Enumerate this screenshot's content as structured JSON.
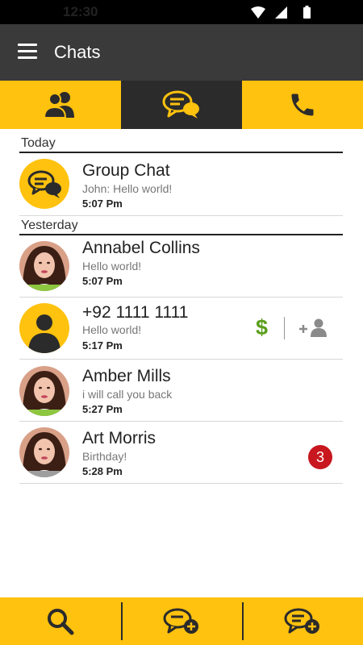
{
  "status_bar": {
    "time": "12:30"
  },
  "app_bar": {
    "title": "Chats",
    "menu_icon": "hamburger-menu-icon"
  },
  "tabs": [
    {
      "icon": "contacts-icon",
      "active": false
    },
    {
      "icon": "chat-bubbles-icon",
      "active": true
    },
    {
      "icon": "phone-icon",
      "active": false
    }
  ],
  "sections": {
    "today": "Today",
    "yesterday": "Yesterday"
  },
  "chats": [
    {
      "name": "Group Chat",
      "message": "John: Hello world!",
      "time": "5:07 Pm",
      "avatar": "group-chat-icon"
    },
    {
      "name": "Annabel Collins",
      "message": "Hello world!",
      "time": "5:07 Pm",
      "avatar": "photo",
      "presence": "#8dc63f"
    },
    {
      "name": "+92 1111 1111",
      "message": "Hello world!",
      "time": "5:17 Pm",
      "avatar": "default-user-icon",
      "action_symbol": "$"
    },
    {
      "name": "Amber Mills",
      "message": "i will call you back",
      "time": "5:27 Pm",
      "avatar": "photo",
      "presence": "#8dc63f"
    },
    {
      "name": "Art Morris",
      "message": "Birthday!",
      "time": "5:28 Pm",
      "avatar": "photo",
      "presence": "#9e9e9e",
      "unread": "3"
    }
  ],
  "bottom_bar": [
    {
      "icon": "search-icon"
    },
    {
      "icon": "new-chat-icon"
    },
    {
      "icon": "new-group-chat-icon"
    }
  ],
  "colors": {
    "accent": "#ffc20e",
    "dark": "#2b2b2b",
    "appbar": "#3a3a3a",
    "badge": "#c8171e",
    "dollar": "#5a9e1c"
  }
}
